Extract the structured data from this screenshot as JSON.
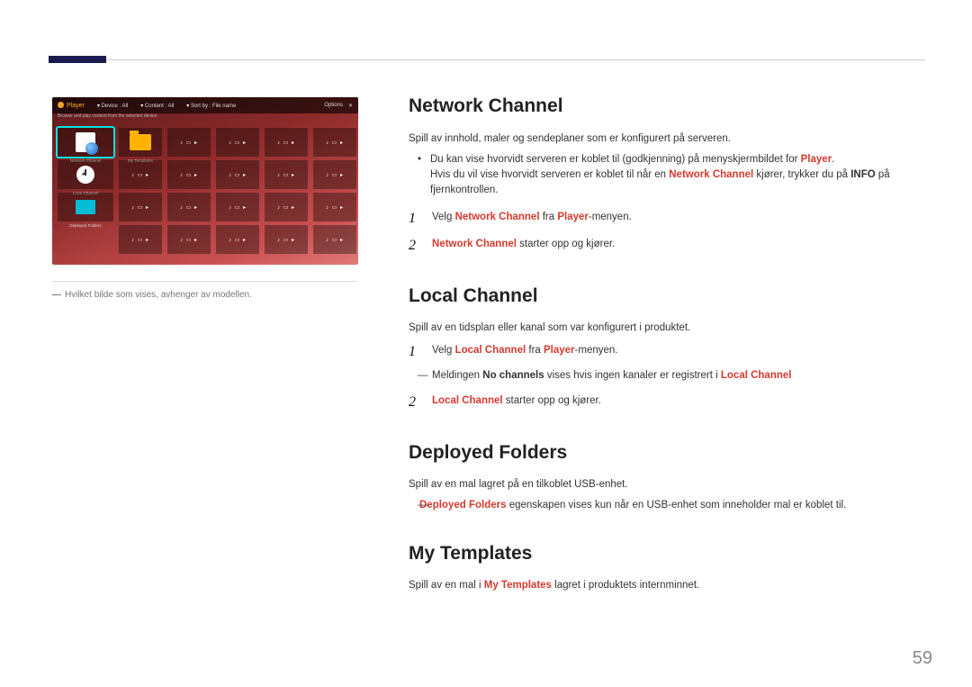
{
  "page_number": "59",
  "screenshot": {
    "header": {
      "player": "Player",
      "device": "Device : All",
      "content": "Content : All",
      "sort": "Sort by : File name",
      "options": "Options",
      "subtitle": "Browse and play content from the selected device."
    },
    "big_tiles": [
      "Network Channel",
      "My Templates",
      "Local Channel",
      "Deployed Folders"
    ],
    "media_glyph": "♪ ▭ ▸"
  },
  "caption": {
    "dash": "―",
    "text": "Hvilket bilde som vises, avhenger av modellen."
  },
  "sections": {
    "network": {
      "title": "Network Channel",
      "intro": "Spill av innhold, maler og sendeplaner som er konfigurert på serveren.",
      "bullets": {
        "b1_pre": "Du kan vise hvorvidt serveren er koblet til (godkjenning) på menyskjermbildet for ",
        "b1_red": "Player",
        "b1_post": ".",
        "b2_pre": "Hvis du vil vise hvorvidt serveren er koblet til når en ",
        "b2_red": "Network Channel",
        "b2_mid": " kjører, trykker du på ",
        "b2_bold": "INFO",
        "b2_post": " på fjernkontrollen."
      },
      "step1": {
        "pre": "Velg ",
        "red1": "Network Channel",
        "mid": " fra ",
        "red2": "Player",
        "post": "-menyen."
      },
      "step2": {
        "red": "Network Channel",
        "post": " starter opp og kjører."
      }
    },
    "local": {
      "title": "Local Channel",
      "intro": "Spill av en tidsplan eller kanal som var konfigurert i produktet.",
      "step1": {
        "pre": "Velg ",
        "red1": "Local Channel",
        "mid": " fra ",
        "red2": "Player",
        "post": "-menyen."
      },
      "note": {
        "pre": "Meldingen ",
        "bold": "No channels",
        "mid": " vises hvis ingen kanaler er registrert i ",
        "red": "Local Channel"
      },
      "step2": {
        "red": "Local Channel",
        "post": " starter opp og kjører."
      }
    },
    "deployed": {
      "title": "Deployed Folders",
      "intro": "Spill av en mal lagret på en tilkoblet USB-enhet.",
      "note": {
        "red": "Deployed Folders",
        "post": " egenskapen vises kun når en USB-enhet som inneholder mal er koblet til."
      }
    },
    "templates": {
      "title": "My Templates",
      "intro_pre": "Spill av en mal i ",
      "intro_red": "My Templates",
      "intro_post": " lagret i produktets internminnet."
    }
  }
}
